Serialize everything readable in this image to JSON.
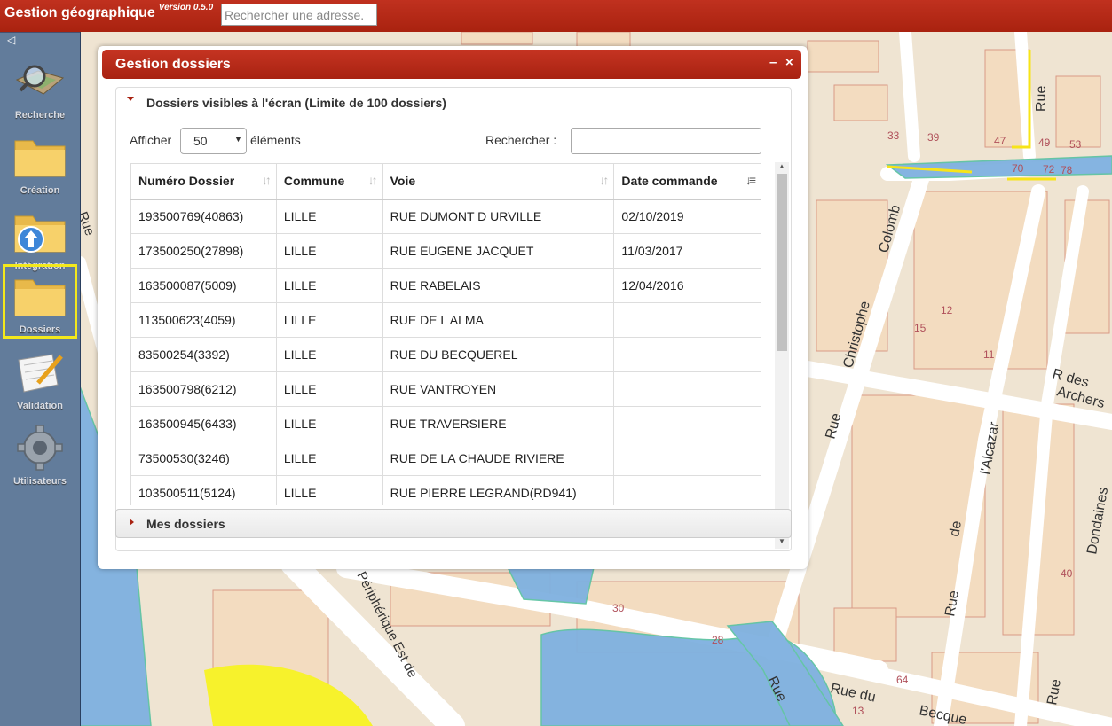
{
  "app": {
    "title": "Gestion géographique",
    "version": "Version 0.5.0"
  },
  "address_search": {
    "placeholder": "Rechercher une adresse."
  },
  "sidebar": {
    "items": [
      {
        "label": "Recherche"
      },
      {
        "label": "Création"
      },
      {
        "label": "Intégration"
      },
      {
        "label": "Dossiers"
      },
      {
        "label": "Validation"
      },
      {
        "label": "Utilisateurs"
      }
    ]
  },
  "dialog": {
    "title": "Gestion dossiers",
    "minimize": "–",
    "close": "×",
    "panel_visible": {
      "title": "Dossiers visibles à l'écran (Limite de 100 dossiers)"
    },
    "show_label": "Afficher",
    "page_size": "50",
    "elements_label": "éléments",
    "search_label": "Rechercher :",
    "table": {
      "headers": [
        "Numéro Dossier",
        "Commune",
        "Voie",
        "Date commande"
      ],
      "rows": [
        [
          "193500769(40863)",
          "LILLE",
          "RUE DUMONT D URVILLE",
          "02/10/2019"
        ],
        [
          "173500250(27898)",
          "LILLE",
          "RUE EUGENE JACQUET",
          "11/03/2017"
        ],
        [
          "163500087(5009)",
          "LILLE",
          "RUE RABELAIS",
          "12/04/2016"
        ],
        [
          "113500623(4059)",
          "LILLE",
          "RUE DE L ALMA",
          ""
        ],
        [
          "83500254(3392)",
          "LILLE",
          "RUE DU BECQUEREL",
          ""
        ],
        [
          "163500798(6212)",
          "LILLE",
          "RUE VANTROYEN",
          ""
        ],
        [
          "163500945(6433)",
          "LILLE",
          "RUE TRAVERSIERE",
          ""
        ],
        [
          "73500530(3246)",
          "LILLE",
          "RUE DE LA CHAUDE RIVIERE",
          ""
        ],
        [
          "103500511(5124)",
          "LILLE",
          "RUE PIERRE LEGRAND(RD941)",
          ""
        ]
      ]
    },
    "panel_mine": {
      "title": "Mes dossiers"
    }
  },
  "map_labels": {
    "colomb": "Colomb",
    "christophe": "Christophe",
    "rue": "Rue",
    "rdes": "R des",
    "archers": "Archers",
    "alcazar": "l'Alcazar",
    "de": "de",
    "dondaines": "Dondaines",
    "peripherique": "Périphérique Est de",
    "rue_du": "Rue du",
    "becquerel": "Becque",
    "n33": "33",
    "n39": "39",
    "n47": "47",
    "n49": "49",
    "n53": "53",
    "n70": "70",
    "n72": "72",
    "n78": "78",
    "n30": "30",
    "n28": "28",
    "n15": "15",
    "n12": "12",
    "n11": "11",
    "n40": "40",
    "n64": "64",
    "n13": "13"
  },
  "colors": {
    "header_red": "#b0281a",
    "map_water": "#7fb1e0",
    "map_yellow": "#f7f22c",
    "sidebar_blue": "#3a5f8c",
    "highlight": "#f3e81c"
  }
}
